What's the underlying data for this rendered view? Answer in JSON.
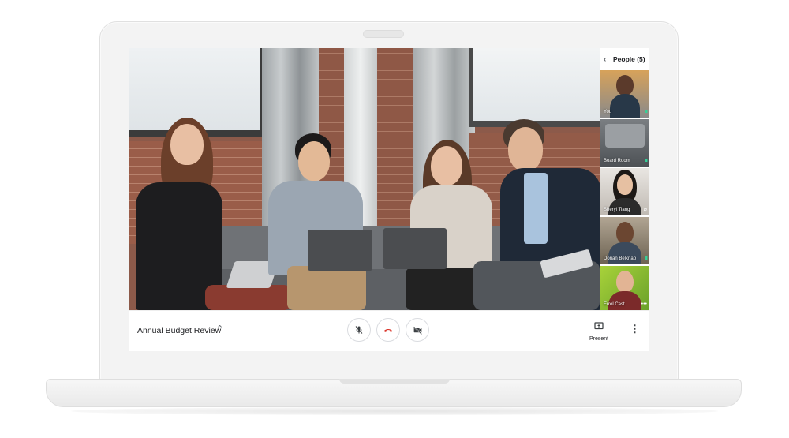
{
  "meeting": {
    "title": "Annual Budget Review"
  },
  "controls": {
    "mic": {
      "icon": "mic-off-icon",
      "state": "muted"
    },
    "hangup": {
      "icon": "hangup-icon",
      "color": "#d93025"
    },
    "camera": {
      "icon": "camera-off-icon",
      "state": "off"
    },
    "present_label": "Present",
    "more": {
      "icon": "more-vert-icon"
    }
  },
  "people_panel": {
    "title": "People (5)",
    "participants": [
      {
        "name": "You",
        "indicator": "speaking-icon"
      },
      {
        "name": "Board Room",
        "indicator": "speaking-icon"
      },
      {
        "name": "Sheryl Tiang",
        "indicator": "mic-off-icon"
      },
      {
        "name": "Dorian Belknap",
        "indicator": "speaking-icon"
      },
      {
        "name": "Errol Cast",
        "indicator": "more-icon"
      }
    ]
  },
  "colors": {
    "accent_green": "#34d399",
    "hangup_red": "#d93025",
    "text_primary": "#202124"
  }
}
